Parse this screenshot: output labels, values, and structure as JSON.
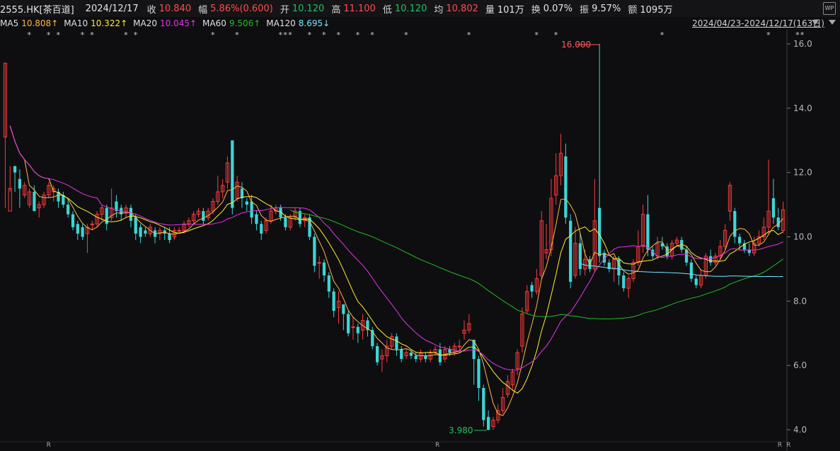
{
  "header": {
    "symbol": "2555.HK[茶百道]",
    "date": "2024/12/17",
    "close_label": "收",
    "close": "10.840",
    "change_label": "幅",
    "change": "5.86%(0.600)",
    "open_label": "开",
    "open": "10.120",
    "high_label": "高",
    "high": "11.100",
    "low_label": "低",
    "low": "10.120",
    "avg_label": "均",
    "avg": "10.802",
    "volume_label": "量",
    "volume": "101万",
    "turnover_label": "换",
    "turnover": "0.07%",
    "amplitude_label": "振",
    "amplitude": "9.57%",
    "amount_label": "额",
    "amount": "1095万",
    "wp_icon": "WP"
  },
  "ma_bar": {
    "ma5_label": "MA5",
    "ma5": "10.808↑",
    "ma10_label": "MA10",
    "ma10": "10.322↑",
    "ma20_label": "MA20",
    "ma20": "10.045↑",
    "ma60_label": "MA60",
    "ma60": "9.506↑",
    "ma120_label": "MA120",
    "ma120": "8.695↓",
    "range": "2024/04/23-2024/12/17(163日)"
  },
  "colors": {
    "up": "#ff3b3b",
    "down": "#3cd6d6",
    "ma5": "#ffb74a",
    "ma10": "#ffee33",
    "ma20": "#e633e6",
    "ma60": "#22bb22",
    "ma120": "#77e6ff"
  },
  "chart_data": {
    "type": "candlestick",
    "ylim": [
      3.9,
      16.2
    ],
    "yticks": [
      "16.0",
      "14.0",
      "12.0",
      "10.0",
      "8.0",
      "6.0",
      "4.0"
    ],
    "high_annotation": "16.000",
    "low_annotation": "3.980",
    "bottom_markers": [
      "R",
      "R",
      "R",
      "R"
    ],
    "candles": [
      [
        13.1,
        15.4,
        10.9,
        15.4
      ],
      [
        10.8,
        11.5,
        11.4,
        12.2
      ],
      [
        12.2,
        12.0,
        11.4,
        12.2
      ],
      [
        11.8,
        11.5,
        10.9,
        12.1
      ],
      [
        11.3,
        11.6,
        11.2,
        11.7
      ],
      [
        11.0,
        11.4,
        10.9,
        11.5
      ],
      [
        11.4,
        10.8,
        10.8,
        11.6
      ],
      [
        10.9,
        11.0,
        10.6,
        11.1
      ],
      [
        11.0,
        11.3,
        10.9,
        11.4
      ],
      [
        11.3,
        11.6,
        11.2,
        11.7
      ],
      [
        11.4,
        11.5,
        11.1,
        11.6
      ],
      [
        11.4,
        11.1,
        10.9,
        11.5
      ],
      [
        11.3,
        11.0,
        10.9,
        11.4
      ],
      [
        11.0,
        10.7,
        10.6,
        11.2
      ],
      [
        10.7,
        10.3,
        10.2,
        10.8
      ],
      [
        10.4,
        10.1,
        9.9,
        10.5
      ],
      [
        10.3,
        10.0,
        9.9,
        10.4
      ],
      [
        10.1,
        10.3,
        9.5,
        10.4
      ],
      [
        10.4,
        10.4,
        10.2,
        10.5
      ],
      [
        10.4,
        10.7,
        10.3,
        10.8
      ],
      [
        10.7,
        10.9,
        10.5,
        11.0
      ],
      [
        10.9,
        10.4,
        10.2,
        11.0
      ],
      [
        10.6,
        10.9,
        10.5,
        11.5
      ],
      [
        11.1,
        10.8,
        10.6,
        11.3
      ],
      [
        10.9,
        10.7,
        10.5,
        11.0
      ],
      [
        10.8,
        10.9,
        10.6,
        11.0
      ],
      [
        10.9,
        10.5,
        10.3,
        11.0
      ],
      [
        10.6,
        10.1,
        9.9,
        10.7
      ],
      [
        10.3,
        10.0,
        9.8,
        10.4
      ],
      [
        10.2,
        10.1,
        10.0,
        10.3
      ],
      [
        10.1,
        10.3,
        10.0,
        10.4
      ],
      [
        10.2,
        10.0,
        9.8,
        10.3
      ],
      [
        10.1,
        10.2,
        9.9,
        10.3
      ],
      [
        10.2,
        10.1,
        9.9,
        10.3
      ],
      [
        10.1,
        9.9,
        9.8,
        10.3
      ],
      [
        10.0,
        10.2,
        9.9,
        10.3
      ],
      [
        10.2,
        10.2,
        10.1,
        10.3
      ],
      [
        10.2,
        10.4,
        10.1,
        10.5
      ],
      [
        10.4,
        10.5,
        10.3,
        10.6
      ],
      [
        10.5,
        10.7,
        10.4,
        10.8
      ],
      [
        10.7,
        10.8,
        10.6,
        10.9
      ],
      [
        10.8,
        10.5,
        10.4,
        10.9
      ],
      [
        10.6,
        10.8,
        10.5,
        10.9
      ],
      [
        10.8,
        11.1,
        10.7,
        11.2
      ],
      [
        11.1,
        11.4,
        11.0,
        11.9
      ],
      [
        11.4,
        11.6,
        11.2,
        11.8
      ],
      [
        11.7,
        12.3,
        11.5,
        12.5
      ],
      [
        13.0,
        10.9,
        10.7,
        13.0
      ],
      [
        11.2,
        11.7,
        11.1,
        11.9
      ],
      [
        11.5,
        11.2,
        10.9,
        11.7
      ],
      [
        11.1,
        11.0,
        10.8,
        11.2
      ],
      [
        11.1,
        10.6,
        10.4,
        11.3
      ],
      [
        10.7,
        10.4,
        10.2,
        10.8
      ],
      [
        10.4,
        10.1,
        9.9,
        10.5
      ],
      [
        10.2,
        10.5,
        10.1,
        10.6
      ],
      [
        10.5,
        10.8,
        10.4,
        11.0
      ],
      [
        10.8,
        10.9,
        10.7,
        11.0
      ],
      [
        10.9,
        10.6,
        10.5,
        11.0
      ],
      [
        10.6,
        10.3,
        10.2,
        10.7
      ],
      [
        10.3,
        10.6,
        10.2,
        10.7
      ],
      [
        10.6,
        10.8,
        10.5,
        10.9
      ],
      [
        10.8,
        10.4,
        10.3,
        10.9
      ],
      [
        10.5,
        10.6,
        10.3,
        10.7
      ],
      [
        10.6,
        10.0,
        9.9,
        10.7
      ],
      [
        10.0,
        9.1,
        8.9,
        10.1
      ],
      [
        9.2,
        9.2,
        8.7,
        9.4
      ],
      [
        9.2,
        8.8,
        8.6,
        9.3
      ],
      [
        8.8,
        8.3,
        8.1,
        8.9
      ],
      [
        8.3,
        7.7,
        7.5,
        8.4
      ],
      [
        7.8,
        8.0,
        7.3,
        8.3
      ],
      [
        7.9,
        7.6,
        7.1,
        7.9
      ],
      [
        7.6,
        7.0,
        6.9,
        7.7
      ],
      [
        7.2,
        7.2,
        6.8,
        7.5
      ],
      [
        7.2,
        7.0,
        6.7,
        7.3
      ],
      [
        7.1,
        7.4,
        6.8,
        7.6
      ],
      [
        7.4,
        7.1,
        6.9,
        7.5
      ],
      [
        7.1,
        6.6,
        6.5,
        7.2
      ],
      [
        6.6,
        6.1,
        6.0,
        6.7
      ],
      [
        6.2,
        6.3,
        5.8,
        6.5
      ],
      [
        6.3,
        6.6,
        6.1,
        6.8
      ],
      [
        6.6,
        6.9,
        6.5,
        7.0
      ],
      [
        6.9,
        6.5,
        6.3,
        7.0
      ],
      [
        6.5,
        6.2,
        6.1,
        6.6
      ],
      [
        6.3,
        6.4,
        6.2,
        6.5
      ],
      [
        6.4,
        6.3,
        6.2,
        6.5
      ],
      [
        6.3,
        6.2,
        6.1,
        6.4
      ],
      [
        6.2,
        6.4,
        6.1,
        6.5
      ],
      [
        6.3,
        6.2,
        6.1,
        6.4
      ],
      [
        6.2,
        6.4,
        6.1,
        6.5
      ],
      [
        6.4,
        6.5,
        6.3,
        6.6
      ],
      [
        6.5,
        6.1,
        6.0,
        6.7
      ],
      [
        6.2,
        6.5,
        6.1,
        6.6
      ],
      [
        6.5,
        6.4,
        6.3,
        6.6
      ],
      [
        6.4,
        6.6,
        6.3,
        6.7
      ],
      [
        6.6,
        6.6,
        6.4,
        6.8
      ],
      [
        7.0,
        7.1,
        6.8,
        7.4
      ],
      [
        7.1,
        7.3,
        7.0,
        7.6
      ],
      [
        6.8,
        6.2,
        5.4,
        6.8
      ],
      [
        6.2,
        5.3,
        4.9,
        6.3
      ],
      [
        5.3,
        4.3,
        4.1,
        5.4
      ],
      [
        4.4,
        4.0,
        3.98,
        4.6
      ],
      [
        4.1,
        4.3,
        4.0,
        4.4
      ],
      [
        4.3,
        4.6,
        4.2,
        4.8
      ],
      [
        4.6,
        5.0,
        4.5,
        5.3
      ],
      [
        5.1,
        5.5,
        5.0,
        5.7
      ],
      [
        5.4,
        5.8,
        5.2,
        5.9
      ],
      [
        5.9,
        6.4,
        5.7,
        6.5
      ],
      [
        6.6,
        7.6,
        6.4,
        7.8
      ],
      [
        7.7,
        8.3,
        7.6,
        8.5
      ],
      [
        8.5,
        8.3,
        8.1,
        8.6
      ],
      [
        8.3,
        8.7,
        8.2,
        9.0
      ],
      [
        8.8,
        10.5,
        8.7,
        10.8
      ],
      [
        9.5,
        9.6,
        9.3,
        10.4
      ],
      [
        9.6,
        11.2,
        9.4,
        11.8
      ],
      [
        11.3,
        11.9,
        11.0,
        12.6
      ],
      [
        11.9,
        12.6,
        11.6,
        13.2
      ],
      [
        12.5,
        10.6,
        10.4,
        12.9
      ],
      [
        10.5,
        8.6,
        8.4,
        10.7
      ],
      [
        8.8,
        9.8,
        8.7,
        10.3
      ],
      [
        9.8,
        9.0,
        8.8,
        10.1
      ],
      [
        9.0,
        9.3,
        8.8,
        9.6
      ],
      [
        9.3,
        9.0,
        8.9,
        9.4
      ],
      [
        9.0,
        10.5,
        8.9,
        11.8
      ],
      [
        10.9,
        9.4,
        9.2,
        16.0
      ],
      [
        9.5,
        9.2,
        9.1,
        9.6
      ],
      [
        9.2,
        9.0,
        8.9,
        9.3
      ],
      [
        9.0,
        9.3,
        8.6,
        9.4
      ],
      [
        9.3,
        8.8,
        8.5,
        9.4
      ],
      [
        8.8,
        8.4,
        8.3,
        8.9
      ],
      [
        8.4,
        8.7,
        8.1,
        8.8
      ],
      [
        8.7,
        9.2,
        8.6,
        9.3
      ],
      [
        9.2,
        9.7,
        9.1,
        10.2
      ],
      [
        9.7,
        10.7,
        9.5,
        11.0
      ],
      [
        10.7,
        9.6,
        9.4,
        11.3
      ],
      [
        9.6,
        9.4,
        9.3,
        9.7
      ],
      [
        9.4,
        9.8,
        9.3,
        10.0
      ],
      [
        9.8,
        9.7,
        9.6,
        10.0
      ],
      [
        9.7,
        9.4,
        9.3,
        9.8
      ],
      [
        9.4,
        9.8,
        9.3,
        9.9
      ],
      [
        9.8,
        9.9,
        9.7,
        10.0
      ],
      [
        9.9,
        9.6,
        9.5,
        10.0
      ],
      [
        9.6,
        9.2,
        9.1,
        9.7
      ],
      [
        9.2,
        8.7,
        8.6,
        9.3
      ],
      [
        8.7,
        8.5,
        8.4,
        8.8
      ],
      [
        8.5,
        8.8,
        8.4,
        9.0
      ],
      [
        8.8,
        9.4,
        8.7,
        9.5
      ],
      [
        9.4,
        9.2,
        9.1,
        9.6
      ],
      [
        9.2,
        9.4,
        9.1,
        9.5
      ],
      [
        9.4,
        9.7,
        9.3,
        9.9
      ],
      [
        9.7,
        10.2,
        9.6,
        10.4
      ],
      [
        10.8,
        11.6,
        10.5,
        11.7
      ],
      [
        10.8,
        10.0,
        9.8,
        10.9
      ],
      [
        10.0,
        9.8,
        9.6,
        10.1
      ],
      [
        9.8,
        9.6,
        9.5,
        9.9
      ],
      [
        9.6,
        9.5,
        9.4,
        9.8
      ],
      [
        9.5,
        9.8,
        9.4,
        10.0
      ],
      [
        9.8,
        10.0,
        9.7,
        10.2
      ],
      [
        10.0,
        10.3,
        9.9,
        10.6
      ],
      [
        10.3,
        10.8,
        10.1,
        12.4
      ],
      [
        11.2,
        10.6,
        10.4,
        11.8
      ],
      [
        10.6,
        10.3,
        10.2,
        10.9
      ],
      [
        10.2,
        10.84,
        10.12,
        11.1
      ]
    ]
  }
}
